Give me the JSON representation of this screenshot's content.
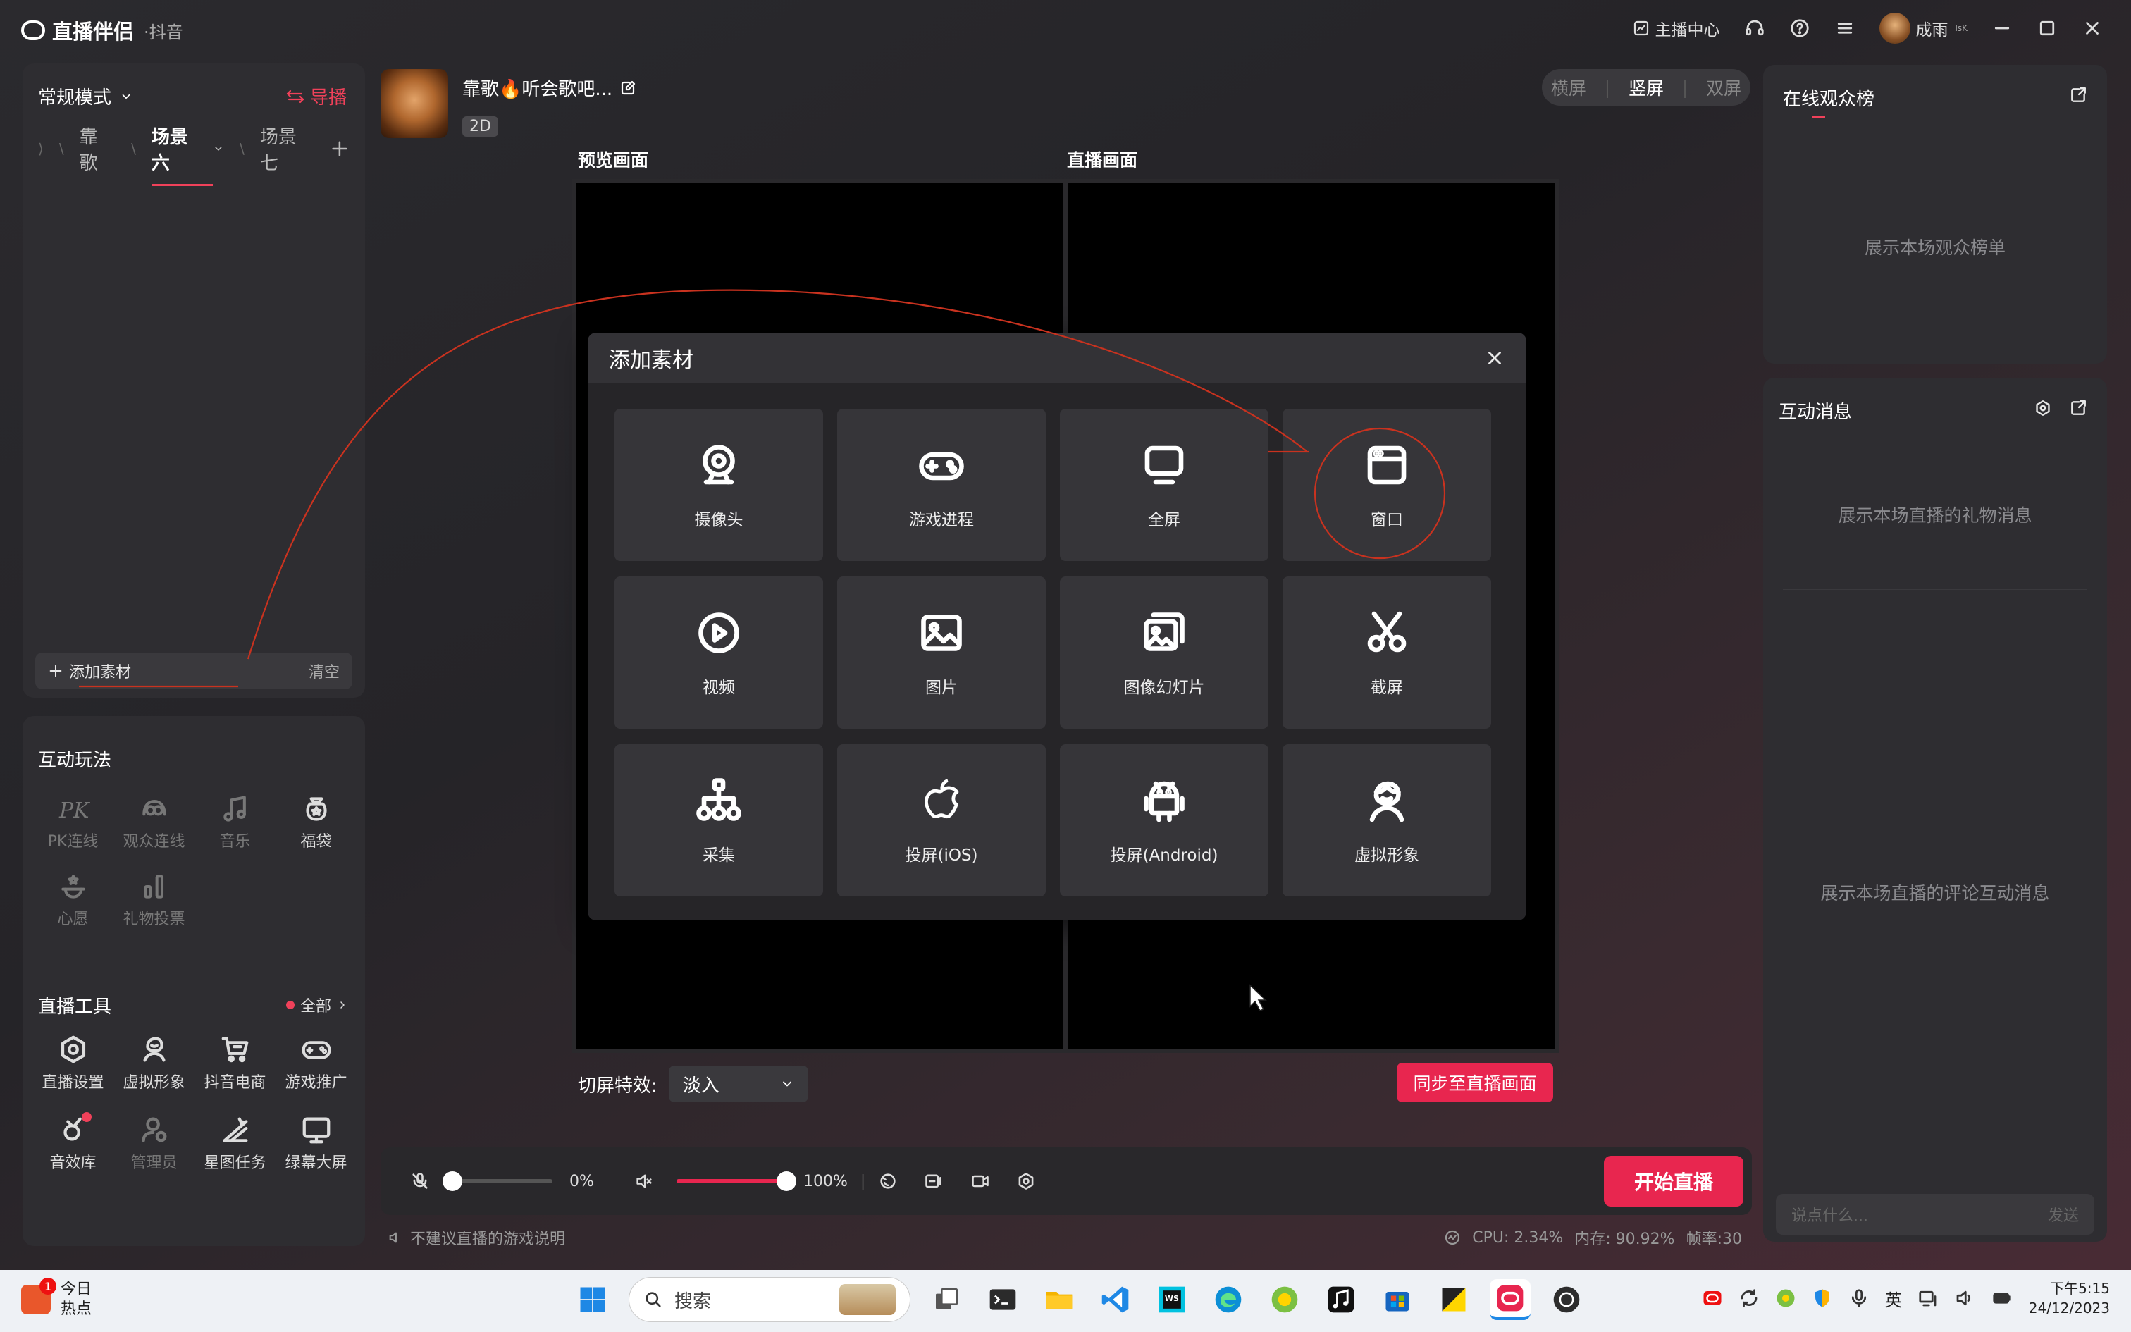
{
  "app": {
    "name": "直播伴侣",
    "platform": "·抖音"
  },
  "titlebar": {
    "center": "主播中心",
    "username": "成雨",
    "username_suffix": "TsK"
  },
  "scene_panel": {
    "mode": "常规模式",
    "guide": "导播",
    "scenes": [
      {
        "label": "靠歌",
        "active": false
      },
      {
        "label": "场景六",
        "active": true
      },
      {
        "label": "场景七",
        "active": false
      }
    ],
    "add_source": "添加素材",
    "clear": "清空"
  },
  "interactive": {
    "title": "互动玩法",
    "items": [
      {
        "label": "PK连线",
        "icon": "pk-icon",
        "enabled": false
      },
      {
        "label": "观众连线",
        "icon": "audience-link-icon",
        "enabled": false
      },
      {
        "label": "音乐",
        "icon": "music-icon",
        "enabled": false
      },
      {
        "label": "福袋",
        "icon": "lucky-bag-icon",
        "enabled": true
      },
      {
        "label": "心愿",
        "icon": "wish-icon",
        "enabled": false
      },
      {
        "label": "礼物投票",
        "icon": "gift-vote-icon",
        "enabled": false
      }
    ]
  },
  "tools": {
    "title": "直播工具",
    "all_label": "全部",
    "items": [
      {
        "label": "直播设置",
        "icon": "live-settings-icon",
        "enabled": true
      },
      {
        "label": "虚拟形象",
        "icon": "avatar-icon",
        "enabled": true
      },
      {
        "label": "抖音电商",
        "icon": "cart-icon",
        "enabled": true
      },
      {
        "label": "游戏推广",
        "icon": "gamepad-icon",
        "enabled": true
      },
      {
        "label": "音效库",
        "icon": "sound-effect-icon",
        "enabled": true
      },
      {
        "label": "管理员",
        "icon": "admin-icon",
        "enabled": false
      },
      {
        "label": "星图任务",
        "icon": "star-task-icon",
        "enabled": true
      },
      {
        "label": "绿幕大屏",
        "icon": "green-screen-icon",
        "enabled": true
      }
    ]
  },
  "stream": {
    "title": "靠歌🔥听会歌吧...",
    "badge": "2D"
  },
  "orientation": {
    "options": [
      "横屏",
      "竖屏",
      "双屏"
    ],
    "selected": "竖屏"
  },
  "preview": {
    "preview_label": "预览画面",
    "live_label": "直播画面"
  },
  "transition": {
    "label": "切屏特效:",
    "value": "淡入"
  },
  "sync_button": "同步至直播画面",
  "controls": {
    "mic_volume": "0%",
    "speaker_volume": "100%",
    "speaker_level": 1.0,
    "mic_level": 0.0
  },
  "go_live": "开始直播",
  "status": {
    "notice": "不建议直播的游戏说明",
    "cpu": "CPU: 2.34%",
    "memory": "内存: 90.92%",
    "fps": "帧率:30"
  },
  "rank": {
    "title": "在线观众榜",
    "empty": "展示本场观众榜单"
  },
  "messages": {
    "title": "互动消息",
    "gift_empty": "展示本场直播的礼物消息",
    "comment_empty": "展示本场直播的评论互动消息",
    "input_placeholder": "说点什么...",
    "send": "发送"
  },
  "modal": {
    "title": "添加素材",
    "selected": "窗口",
    "items": [
      {
        "label": "摄像头",
        "icon": "camera-icon"
      },
      {
        "label": "游戏进程",
        "icon": "game-process-icon"
      },
      {
        "label": "全屏",
        "icon": "monitor-icon"
      },
      {
        "label": "窗口",
        "icon": "window-icon"
      },
      {
        "label": "视频",
        "icon": "video-play-icon"
      },
      {
        "label": "图片",
        "icon": "image-icon"
      },
      {
        "label": "图像幻灯片",
        "icon": "slideshow-icon"
      },
      {
        "label": "截屏",
        "icon": "scissors-icon"
      },
      {
        "label": "采集",
        "icon": "capture-tree-icon"
      },
      {
        "label": "投屏(iOS)",
        "icon": "apple-icon"
      },
      {
        "label": "投屏(Android)",
        "icon": "android-icon"
      },
      {
        "label": "虚拟形象",
        "icon": "virtual-avatar-icon"
      }
    ]
  },
  "taskbar": {
    "news_title": "今日",
    "news_sub": "热点",
    "news_badge": "1",
    "search_placeholder": "搜索",
    "ime": "英",
    "time": "下午5:15",
    "date": "24/12/2023"
  },
  "colors": {
    "accent": "#e8264f",
    "annotation": "#c9321f",
    "panel": "#2e2d31",
    "modal": "#262528"
  }
}
